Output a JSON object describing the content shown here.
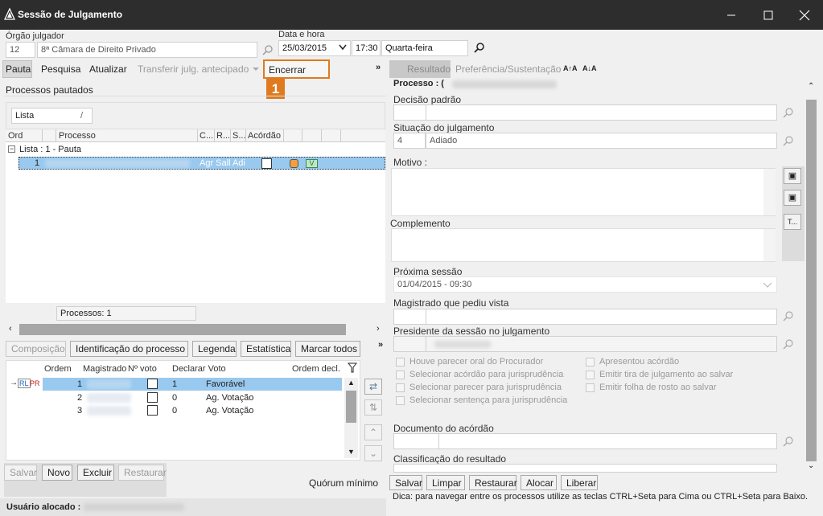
{
  "window": {
    "title": "Sessão de Julgamento"
  },
  "header": {
    "orgao_label": "Órgão julgador",
    "orgao_code": "12",
    "orgao_name": "8ª Câmara de Direito Privado",
    "data_label": "Data e hora",
    "date": "25/03/2015",
    "time": "17:30",
    "weekday": "Quarta-feira"
  },
  "toolbar": {
    "pauta": "Pauta",
    "pesquisa": "Pesquisa",
    "atualizar": "Atualizar",
    "transferir": "Transferir julg. antecipado",
    "encerrar": "Encerrar",
    "badge": "1",
    "resultado": "Resultado",
    "preferencia": "Preferência/Sustentação",
    "font_up": "A↑A",
    "font_down": "A↓A",
    "accent_color": "#e07a20"
  },
  "left": {
    "section_title": "Processos pautados",
    "view_select": "Lista",
    "columns": [
      "Ord",
      "Processo",
      "C...",
      "R...",
      "S...",
      "Acórdão"
    ],
    "group_label": "Lista : 1 - Pauta",
    "row": {
      "ord": "1",
      "status": "Agr Sall Adi"
    },
    "count_label": "Processos: 1"
  },
  "tabs2": [
    "Composição",
    "Identificação do processo",
    "Legenda",
    "Estatística",
    "Marcar todos"
  ],
  "composicao": {
    "columns": [
      "Ordem",
      "Magistrado",
      "Nº voto",
      "Declarar Voto",
      "Ordem decl."
    ],
    "marker": "RL",
    "marker2": "PR",
    "rows": [
      {
        "ordem": "1",
        "voto": "1",
        "declarar": "Favorável"
      },
      {
        "ordem": "2",
        "voto": "0",
        "declarar": "Ag. Votação"
      },
      {
        "ordem": "3",
        "voto": "0",
        "declarar": "Ag. Votação"
      }
    ]
  },
  "bottom_left": {
    "salvar": "Salvar",
    "novo": "Novo",
    "excluir": "Excluir",
    "restaurar": "Restaurar",
    "quorum": "Quórum mínimo",
    "usuario_label": "Usuário alocado :"
  },
  "right": {
    "processo_label": "Processo : (",
    "decisao_label": "Decisão padrão",
    "situacao_label": "Situação do julgamento",
    "situacao_code": "4",
    "situacao_value": "Adiado",
    "motivo_label": "Motivo :",
    "complemento_label": "Complemento",
    "proxima_label": "Próxima sessão",
    "proxima_value": "01/04/2015 - 09:30",
    "magistrado_vista_label": "Magistrado que pediu vista",
    "presidente_label": "Presidente da sessão no julgamento",
    "checks_left": [
      "Houve parecer oral do Procurador",
      "Selecionar acórdão para jurisprudência",
      "Selecionar parecer para jurisprudência",
      "Selecionar sentença para jurisprudência"
    ],
    "checks_right": [
      "Apresentou acórdão",
      "Emitir tira de julgamento ao salvar",
      "Emitir folha de rosto ao salvar"
    ],
    "documento_label": "Documento do acórdão",
    "classificacao_label": "Classificação do resultado",
    "side_btn": "T..."
  },
  "bottom_right": {
    "salvar": "Salvar",
    "limpar": "Limpar",
    "restaurar": "Restaurar",
    "alocar": "Alocar",
    "liberar": "Liberar",
    "dica": "Dica: para navegar entre os processos utilize as teclas CTRL+Seta para Cima ou CTRL+Seta para Baixo."
  }
}
